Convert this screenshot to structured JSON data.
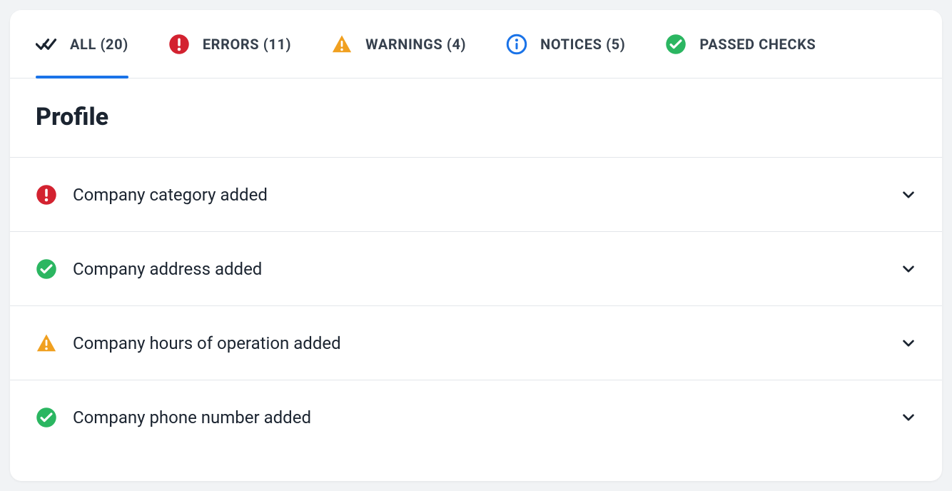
{
  "tabs": {
    "all": {
      "label": "ALL (20)",
      "active": true
    },
    "errors": {
      "label": "ERRORS (11)",
      "active": false
    },
    "warnings": {
      "label": "WARNINGS (4)",
      "active": false
    },
    "notices": {
      "label": "NOTICES (5)",
      "active": false
    },
    "passed": {
      "label": "PASSED CHECKS",
      "active": false
    }
  },
  "section": {
    "title": "Profile"
  },
  "rows": [
    {
      "status": "error",
      "label": "Company category added"
    },
    {
      "status": "passed",
      "label": "Company address added"
    },
    {
      "status": "warning",
      "label": "Company hours of operation added"
    },
    {
      "status": "passed",
      "label": "Company phone number added"
    }
  ],
  "colors": {
    "error": "#d32230",
    "warning": "#f0a020",
    "notice": "#1a73e8",
    "passed": "#2bb661",
    "text": "#36404d"
  }
}
